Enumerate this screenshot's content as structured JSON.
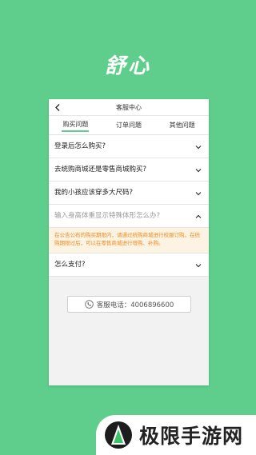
{
  "app": {
    "title": "舒心"
  },
  "nav": {
    "title": "客服中心",
    "back_icon": "chevron-left-icon"
  },
  "tabs": [
    {
      "label": "购买问题",
      "active": true
    },
    {
      "label": "订单问题",
      "active": false
    },
    {
      "label": "其他问题",
      "active": false
    }
  ],
  "faq": [
    {
      "question": "登录后怎么购买?",
      "expanded": false
    },
    {
      "question": "去统购商城还是零售商城购买?",
      "expanded": false
    },
    {
      "question": "我的小孩应该穿多大尺码?",
      "expanded": false
    },
    {
      "question": "输入身高体重显示特殊体形怎么办?",
      "expanded": true,
      "answer": "在公告公布的购买期限内，请通过统购商城进行校服订购。在统购期限过后，可以在零售商城进行增购、补购。"
    },
    {
      "question": "怎么支付?",
      "expanded": false
    }
  ],
  "contact": {
    "label": "客服电话：4006896600",
    "icon": "phone-icon"
  },
  "watermark": {
    "text": "极限手游网"
  },
  "colors": {
    "background": "#5fce8c",
    "accent": "#5fce8c",
    "answer_text": "#f08a1c",
    "answer_bg": "#fdf3e3"
  }
}
